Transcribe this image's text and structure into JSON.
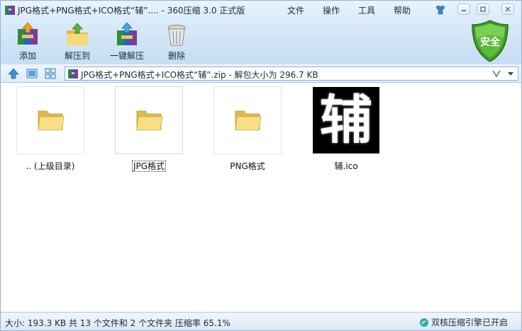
{
  "window": {
    "title": "JPG格式+PNG格式+ICO格式“辅”.... - 360压缩 3.0 正式版"
  },
  "menu": [
    "文件",
    "操作",
    "工具",
    "帮助"
  ],
  "toolbar": {
    "add_label": "添加",
    "extract_label": "解压到",
    "oneclick_label": "一键解压",
    "delete_label": "删除"
  },
  "security_badge": "安全",
  "address": {
    "path": "JPG格式+PNG格式+ICO格式“辅”.zip - 解包大小为 296.7 KB"
  },
  "items": [
    {
      "name": ".. (上级目录)",
      "type": "folder"
    },
    {
      "name": "JPG格式",
      "type": "folder"
    },
    {
      "name": "PNG格式",
      "type": "folder"
    },
    {
      "name": "辅.ico",
      "type": "ico",
      "glyph": "辅"
    }
  ],
  "status": {
    "left": "大小: 193.3 KB 共 13 个文件和 2 个文件夹 压缩率 65.1%",
    "right": "双核压缩引擎已开启"
  },
  "colors": {
    "title_band": "#d9eaf9",
    "security_green": "#4aa52e",
    "folder_yellow": "#f4d46a"
  }
}
